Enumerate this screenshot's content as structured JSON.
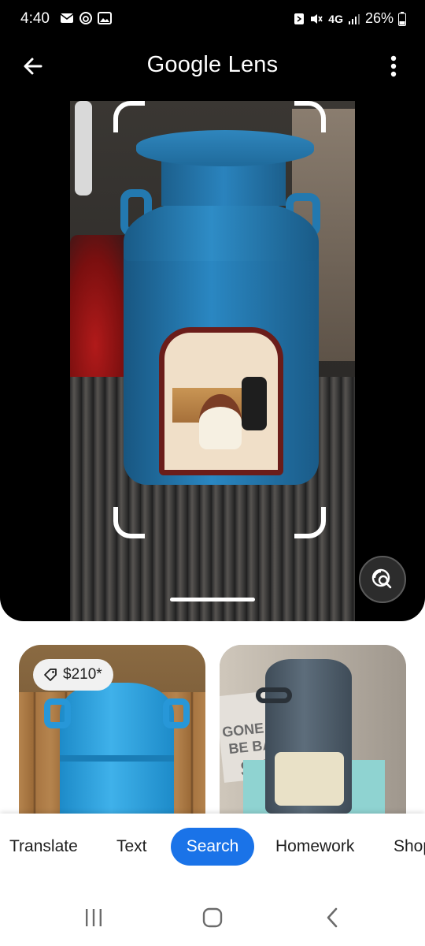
{
  "status_bar": {
    "time": "4:40",
    "network": "4G",
    "battery": "26%",
    "left_icons": [
      "message-icon",
      "threads-icon",
      "image-icon"
    ],
    "right_icons": [
      "nfc-icon",
      "mute-icon",
      "signal-icon",
      "battery-icon"
    ]
  },
  "app_bar": {
    "title_google": "Google",
    "title_lens": "Lens",
    "back_icon": "arrow-back-icon",
    "menu_icon": "more-vert-icon"
  },
  "results": [
    {
      "price": "$210*",
      "price_icon": "tag-icon"
    },
    {
      "sign_text": [
        "GONE S",
        "BE BA",
        "SUN"
      ]
    }
  ],
  "tabs": {
    "translate": "Translate",
    "text": "Text",
    "search": "Search",
    "homework": "Homework",
    "shopping": "Shop",
    "selected": "search",
    "selected_color": "#1a73e8"
  },
  "nav": {
    "recents_icon": "recents-icon",
    "home_icon": "home-icon",
    "back_icon": "nav-back-icon"
  }
}
